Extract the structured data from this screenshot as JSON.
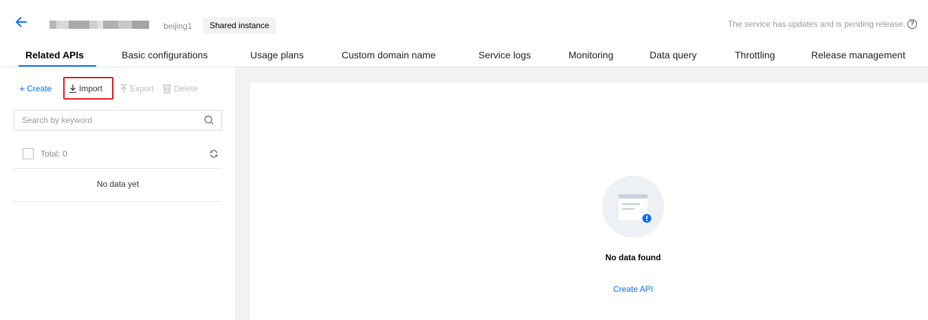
{
  "header": {
    "region": "beijing1",
    "instance_type": "Shared instance",
    "pending_note": "The service has updates and is pending release."
  },
  "tabs": [
    {
      "label": "Related APIs",
      "active": true
    },
    {
      "label": "Basic configurations"
    },
    {
      "label": "Usage plans"
    },
    {
      "label": "Custom domain name"
    },
    {
      "label": "Service logs"
    },
    {
      "label": "Monitoring"
    },
    {
      "label": "Data query"
    },
    {
      "label": "Throttling"
    },
    {
      "label": "Release management"
    }
  ],
  "toolbar": {
    "create": "Create",
    "import": "Import",
    "export": "Export",
    "delete": "Delete"
  },
  "search": {
    "placeholder": "Search by keyword",
    "value": ""
  },
  "list": {
    "total_label": "Total: 0",
    "empty_text": "No data yet"
  },
  "empty_state": {
    "title": "No data found",
    "action": "Create API"
  },
  "colors": {
    "accent": "#006eff",
    "highlight": "#e0161c"
  },
  "icons": {
    "back": "arrow-left-icon",
    "help": "question-circle-icon",
    "create": "plus-icon",
    "import": "download-icon",
    "export": "upload-icon",
    "delete": "trash-icon",
    "search": "search-icon",
    "refresh": "refresh-icon"
  }
}
